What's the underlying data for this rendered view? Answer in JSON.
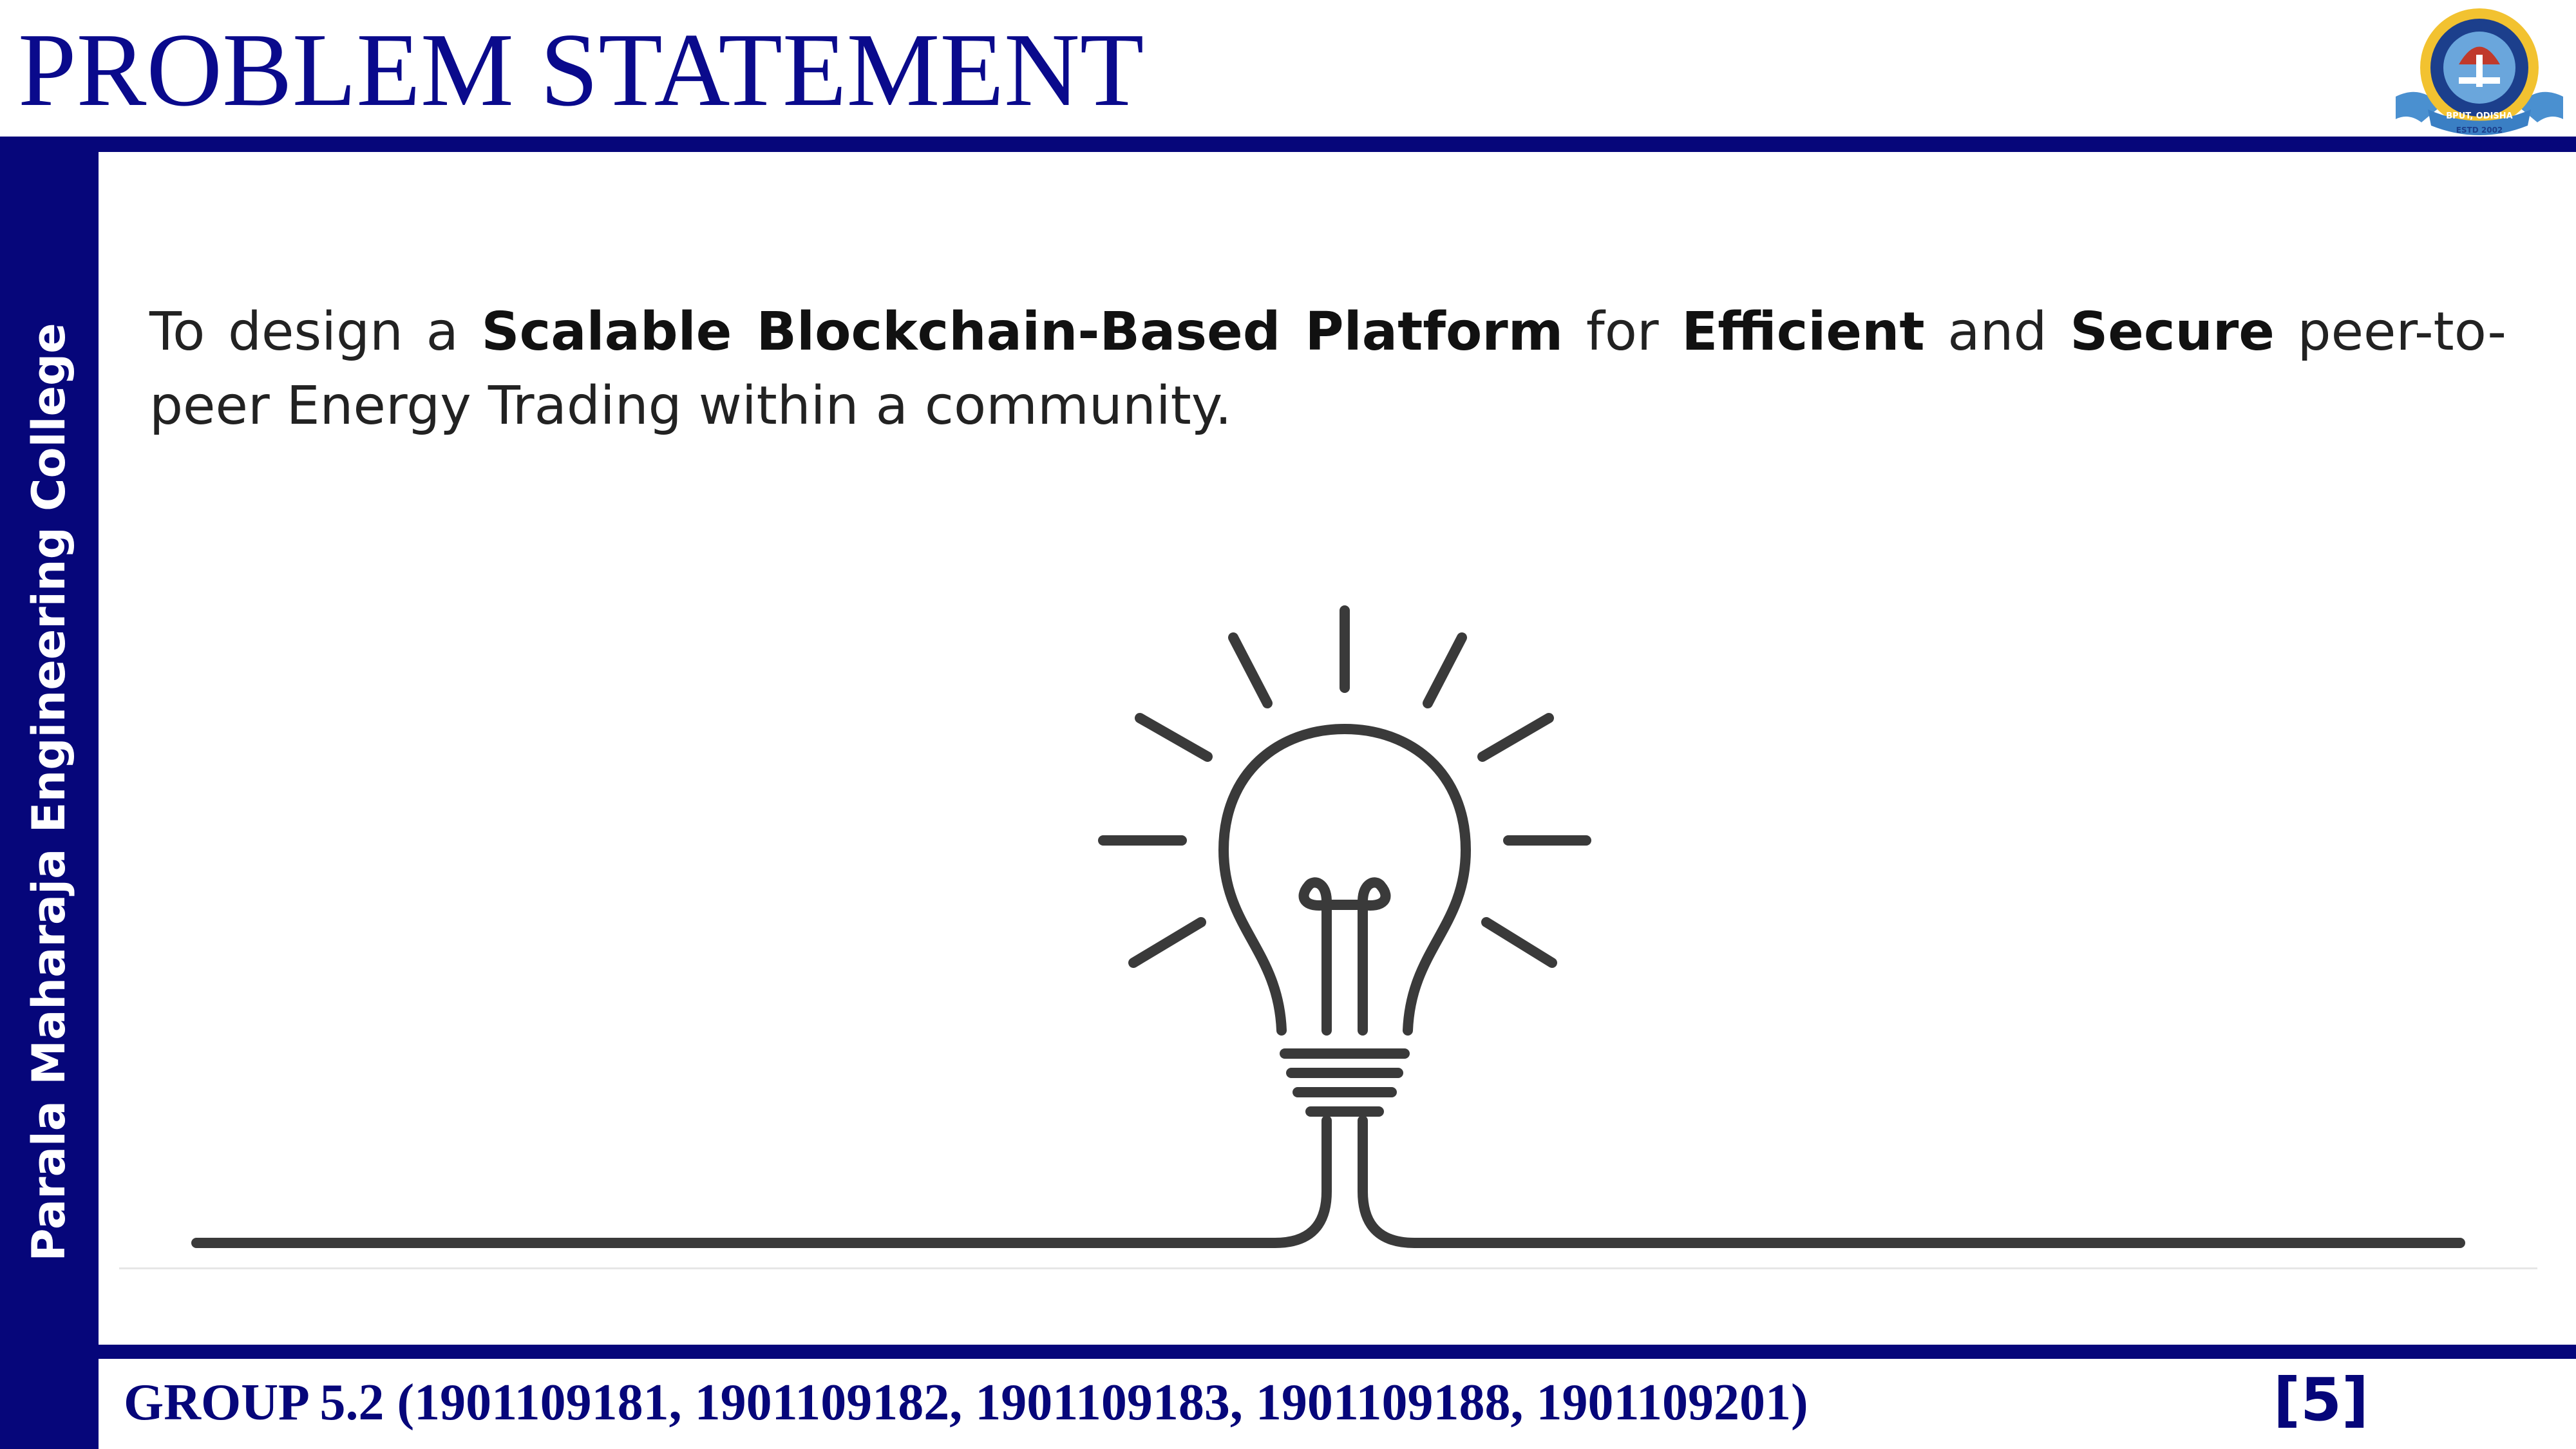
{
  "slide": {
    "title": "PROBLEM STATEMENT",
    "college_name": "Parala Maharaja Engineering College",
    "statement": [
      {
        "text": "To design a ",
        "bold": false
      },
      {
        "text": "Scalable Blockchain-Based Platform",
        "bold": true
      },
      {
        "text": " for ",
        "bold": false
      },
      {
        "text": "Efficient",
        "bold": true
      },
      {
        "text": " and ",
        "bold": false
      },
      {
        "text": "Secure",
        "bold": true
      },
      {
        "text": " peer-to-peer Energy Trading within a community.",
        "bold": false
      }
    ],
    "footer_group": "GROUP 5.2 (1901109181, 1901109182, 1901109183, 1901109188, 1901109201)",
    "page_number": "[5]",
    "logo_text": "BPUT, ODISHA",
    "logo_year": "ESTD 2002"
  },
  "colors": {
    "brand_navy": "#06067a",
    "title_blue": "#0a0a8c",
    "body_text": "#222222",
    "bulb_stroke": "#3a3a3a"
  },
  "icons": {
    "illustration": "lightbulb-icon",
    "logo": "university-emblem-icon"
  }
}
